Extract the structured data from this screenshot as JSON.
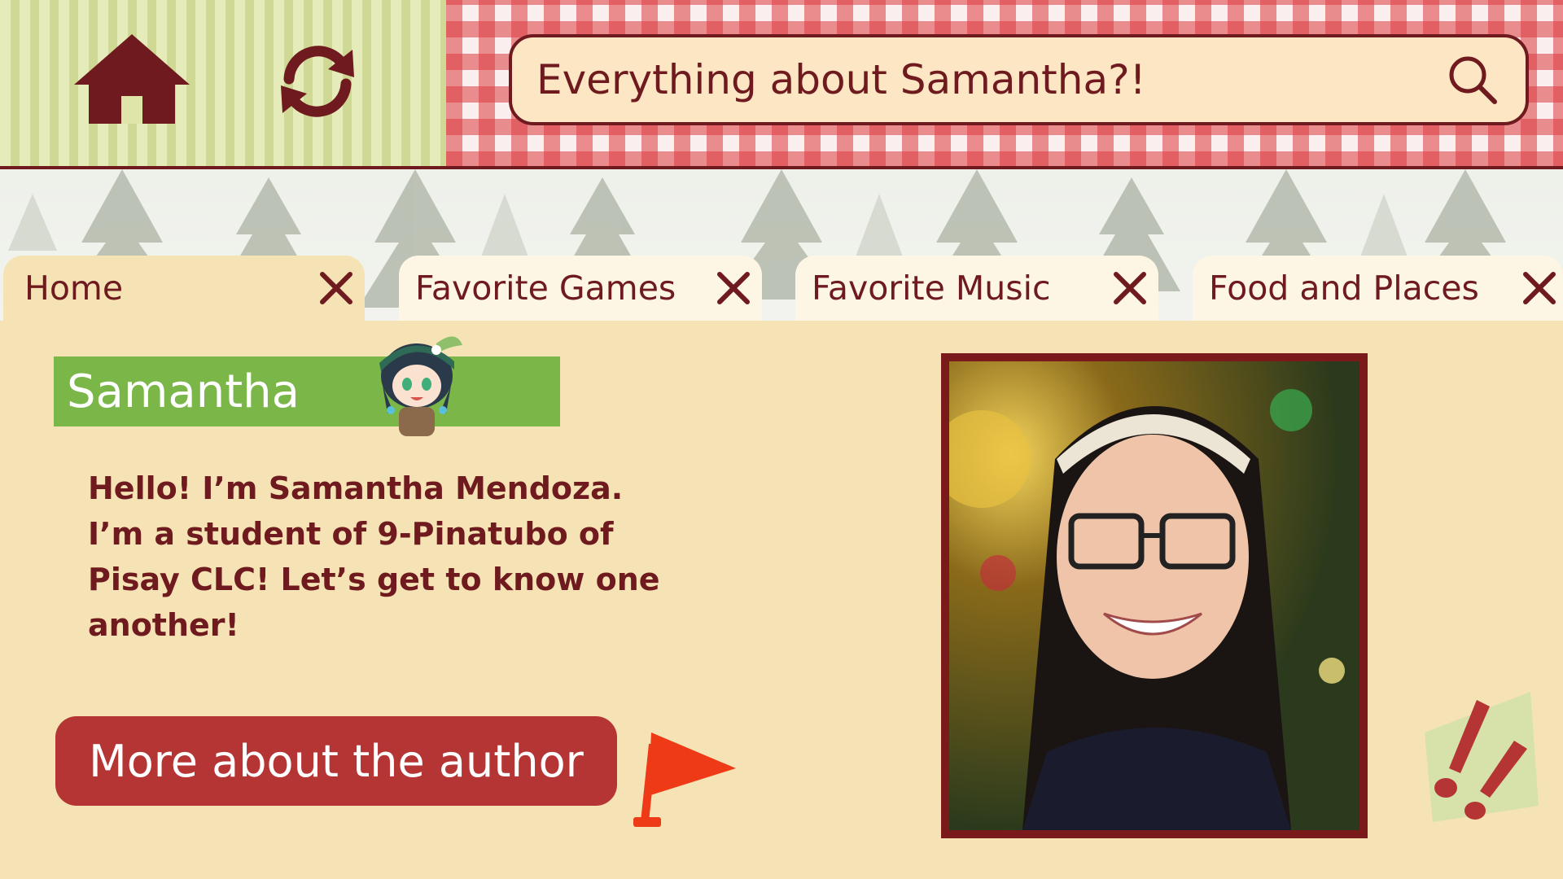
{
  "header": {
    "nav": {
      "home_icon": "home-icon",
      "refresh_icon": "refresh-icon"
    },
    "search": {
      "value": "Everything about Samantha?!",
      "icon": "search-icon"
    }
  },
  "tabs": [
    {
      "label": "Home",
      "active": true
    },
    {
      "label": "Favorite Games",
      "active": false
    },
    {
      "label": "Favorite Music",
      "active": false
    },
    {
      "label": "Food and Places",
      "active": false
    }
  ],
  "profile": {
    "name": "Samantha",
    "intro_lines": [
      "Hello!  I’m Samantha Mendoza.",
      "I’m a student of 9-Pinatubo of",
      "Pisay CLC!  Let’s get to know one",
      "another!"
    ],
    "more_button": "More about the author"
  },
  "colors": {
    "maroon": "#6e1a1e",
    "banner_green": "#7ab648",
    "button_red": "#b53535",
    "page_bg": "#f5e3b5",
    "flag_orange": "#ee3a16"
  }
}
